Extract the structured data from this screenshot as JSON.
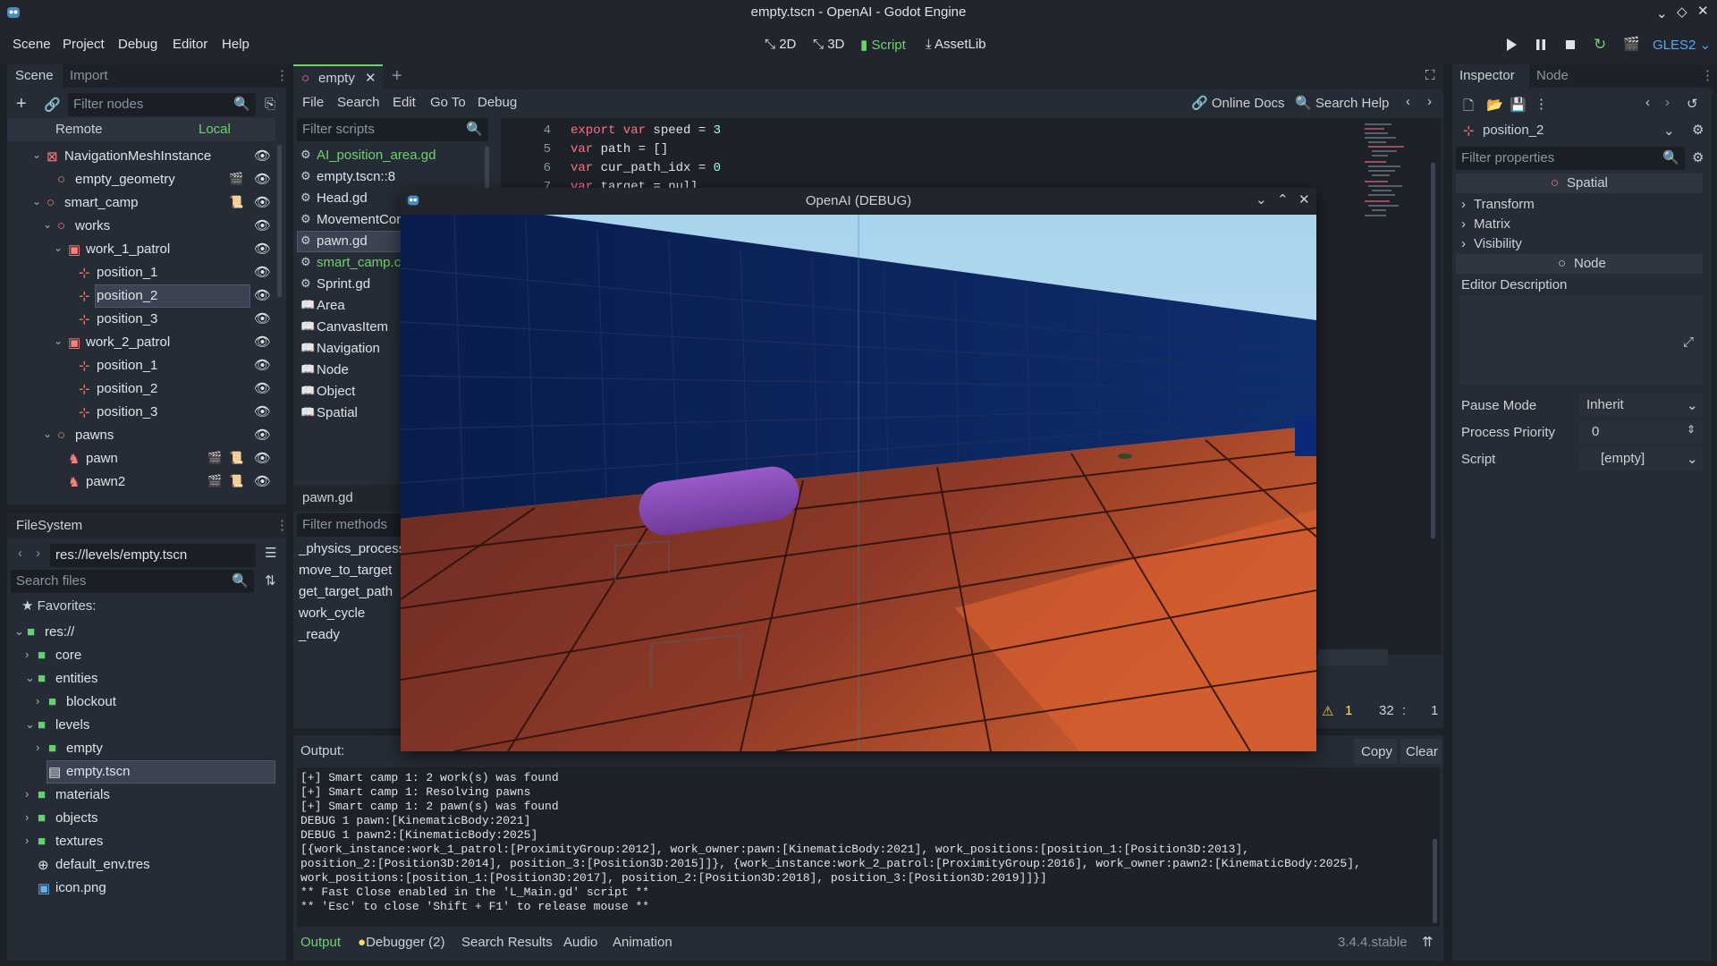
{
  "window": {
    "title": "empty.tscn - OpenAI - Godot Engine"
  },
  "menu": [
    "Scene",
    "Project",
    "Debug",
    "Editor",
    "Help"
  ],
  "workspaces": {
    "d2": "2D",
    "d3": "3D",
    "script": "Script",
    "assetlib": "AssetLib"
  },
  "renderer": "GLES2",
  "scene_dock": {
    "tabs": [
      "Scene",
      "Import"
    ],
    "filter_placeholder": "Filter nodes",
    "remote": "Remote",
    "local": "Local",
    "nodes": [
      "NavigationMeshInstance",
      "empty_geometry",
      "smart_camp",
      "works",
      "work_1_patrol",
      "position_1",
      "position_2",
      "position_3",
      "work_2_patrol",
      "position_1",
      "position_2",
      "position_3",
      "pawns",
      "pawn",
      "pawn2"
    ]
  },
  "filesystem": {
    "title": "FileSystem",
    "path": "res://levels/empty.tscn",
    "search_placeholder": "Search files",
    "favorites": "Favorites:",
    "items": [
      "res://",
      "core",
      "entities",
      "blockout",
      "levels",
      "empty",
      "empty.tscn",
      "materials",
      "objects",
      "textures",
      "default_env.tres",
      "icon.png"
    ]
  },
  "script_editor": {
    "tab": "empty",
    "menu": [
      "File",
      "Search",
      "Edit",
      "Go To",
      "Debug"
    ],
    "online_docs": "Online Docs",
    "search_help": "Search Help",
    "filter_scripts": "Filter scripts",
    "scripts": [
      "AI_position_area.gd",
      "empty.tscn::8",
      "Head.gd",
      "MovementCor",
      "pawn.gd",
      "smart_camp.c",
      "Sprint.gd",
      "Area",
      "CanvasItem",
      "Navigation",
      "Node",
      "Object",
      "Spatial"
    ],
    "current_script": "pawn.gd",
    "filter_methods": "Filter methods",
    "methods": [
      "_physics_process",
      "move_to_target",
      "get_target_path",
      "work_cycle",
      "_ready"
    ],
    "code": [
      {
        "n": "4",
        "kw": "export var",
        "rest": " speed = ",
        "num": "3"
      },
      {
        "n": "5",
        "kw": "var",
        "rest": " path = []",
        "num": ""
      },
      {
        "n": "6",
        "kw": "var",
        "rest": " cur_path_idx = ",
        "num": "0"
      },
      {
        "n": "7",
        "kw": "var",
        "rest": " target = null",
        "num": ""
      }
    ],
    "status": {
      "warnings": "1",
      "line": "32",
      "sep": ":",
      "col": "1"
    }
  },
  "debug_window": {
    "title": "OpenAI (DEBUG)"
  },
  "output": {
    "label": "Output:",
    "copy": "Copy",
    "clear": "Clear",
    "lines": [
      "[+] Smart camp 1: 2 work(s) was found",
      "[+] Smart camp 1: Resolving pawns",
      "[+] Smart camp 1: 2 pawn(s) was found",
      "DEBUG 1 pawn:[KinematicBody:2021]",
      "DEBUG 1 pawn2:[KinematicBody:2025]",
      "[{work_instance:work_1_patrol:[ProximityGroup:2012], work_owner:pawn:[KinematicBody:2021], work_positions:[position_1:[Position3D:2013],",
      "position_2:[Position3D:2014], position_3:[Position3D:2015]]}, {work_instance:work_2_patrol:[ProximityGroup:2016], work_owner:pawn2:[KinematicBody:2025],",
      "work_positions:[position_1:[Position3D:2017], position_2:[Position3D:2018], position_3:[Position3D:2019]]}]",
      "** Fast Close enabled in the 'L_Main.gd' script **",
      "** 'Esc' to close 'Shift + F1' to release mouse **"
    ]
  },
  "bottom_tabs": {
    "output": "Output",
    "debugger": "Debugger (2)",
    "search": "Search Results",
    "audio": "Audio",
    "animation": "Animation",
    "version": "3.4.4.stable"
  },
  "inspector": {
    "tabs": [
      "Inspector",
      "Node"
    ],
    "node_name": "position_2",
    "filter_placeholder": "Filter properties",
    "spatial": "Spatial",
    "sections": [
      "Transform",
      "Matrix",
      "Visibility"
    ],
    "node_header": "Node",
    "editor_desc": "Editor Description",
    "props": [
      {
        "k": "Pause Mode",
        "v": "Inherit"
      },
      {
        "k": "Process Priority",
        "v": "0"
      },
      {
        "k": "Script",
        "v": "[empty]"
      }
    ]
  },
  "colors": {
    "accent": "#6fd26f",
    "node_red": "#fc7f7f",
    "folder": "#5fd46b",
    "keyword": "#ff7085",
    "number": "#a1ffe0",
    "warning": "#ffdd65"
  }
}
